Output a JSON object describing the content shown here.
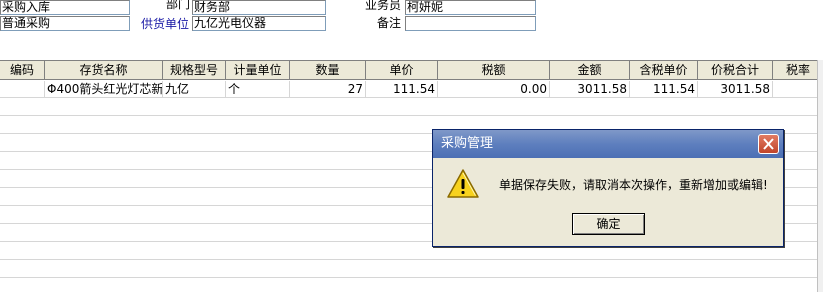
{
  "header": {
    "doc_type_value": "采购入库",
    "purchase_type_value": "普通采购",
    "department_label": "部门",
    "department_value": "财务部",
    "supplier_label": "供货单位",
    "supplier_value": "九亿光电仪器",
    "salesman_label": "业务员",
    "salesman_value": "柯妍妮",
    "remark_label": "备注",
    "remark_value": ""
  },
  "grid": {
    "columns": [
      "编码",
      "存货名称",
      "规格型号",
      "计量单位",
      "数量",
      "单价",
      "税额",
      "金额",
      "含税单价",
      "价税合计",
      "税率"
    ],
    "rows": [
      [
        "",
        "Φ400箭头红光灯芯新",
        "九亿",
        "个",
        "27",
        "111.54",
        "0.00",
        "3011.58",
        "111.54",
        "3011.58",
        ""
      ]
    ]
  },
  "dialog": {
    "title": "采购管理",
    "message": "单据保存失败，请取消本次操作，重新增加或编辑!",
    "ok_label": "确定"
  },
  "colors": {
    "title_bar": "#5e7fbe",
    "close_button": "#c0442a",
    "dialog_bg": "#ece9d8",
    "label_blue": "#1a1aa6"
  },
  "icons": {
    "warning": "warning-icon",
    "close": "close-icon"
  }
}
